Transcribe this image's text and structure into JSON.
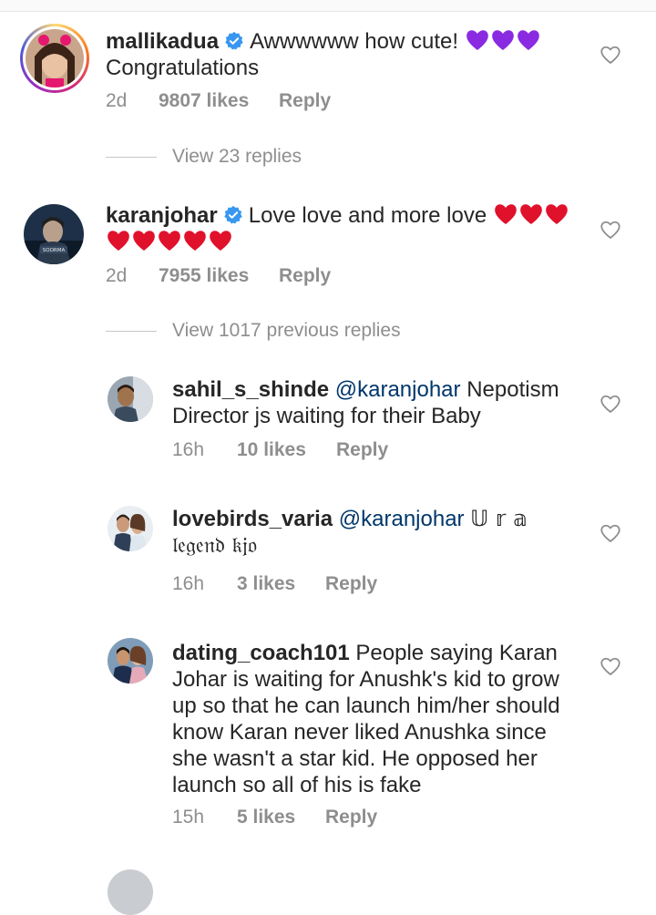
{
  "comments": [
    {
      "username": "mallikadua",
      "verified": true,
      "mention": "",
      "text_line1": "Awwwwww how cute!",
      "text_line2": "Congratulations",
      "emoji": "purple-heart",
      "emoji_count_line1": 3,
      "time": "2d",
      "likes": "9807 likes",
      "reply": "Reply"
    },
    {
      "username": "karanjohar",
      "verified": true,
      "mention": "",
      "text_line1": "Love love and more love",
      "text_line2": "",
      "emoji": "red-heart",
      "emoji_count_line1": 3,
      "emoji_count_line2": 5,
      "time": "2d",
      "likes": "7955 likes",
      "reply": "Reply"
    },
    {
      "username": "sahil_s_shinde",
      "mention": "@karanjohar",
      "text_line1": "Nepotism",
      "text_line2": "Director js waiting for their Baby",
      "time": "16h",
      "likes": "10 likes",
      "reply": "Reply"
    },
    {
      "username": "lovebirds_varia",
      "mention": "@karanjohar",
      "text_line1": "𝕌 𝕣 𝕒",
      "text_line2": "𝔩𝔢𝔤𝔢𝔫𝔡 𝔨𝔧𝔬",
      "time": "16h",
      "likes": "3 likes",
      "reply": "Reply"
    },
    {
      "username": "dating_coach101",
      "mention": "",
      "text_line1": "People saying Karan",
      "text_lines": [
        "Johar is waiting for Anushk's kid to grow",
        "up so that he can launch him/her should",
        "know Karan never liked Anushka since",
        "she wasn't a star kid. He opposed her",
        "launch so all of his is fake"
      ],
      "time": "15h",
      "likes": "5 likes",
      "reply": "Reply"
    }
  ],
  "view_replies": [
    {
      "label": "View 23 replies"
    },
    {
      "label": "View 1017 previous replies"
    }
  ],
  "colors": {
    "text": "#262626",
    "meta": "#8e8e8e",
    "mention": "#00376b",
    "verified": "#3897f0",
    "purple_heart": "#8a2be2",
    "red_heart": "#e0112b"
  }
}
